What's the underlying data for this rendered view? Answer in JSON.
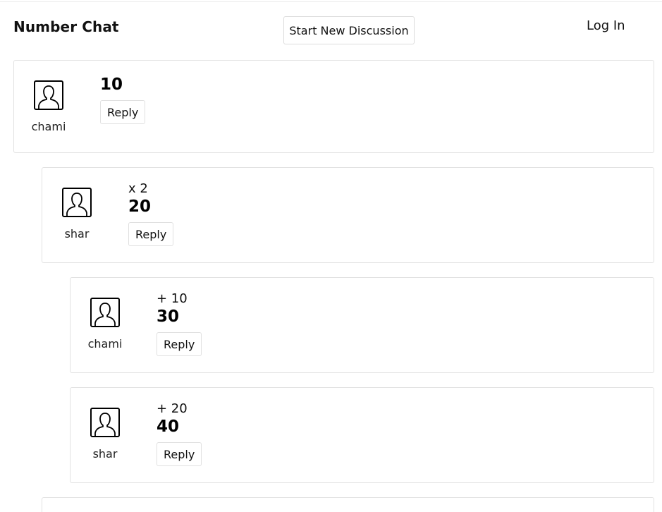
{
  "header": {
    "title": "Number Chat",
    "new_discussion_label": "Start New Discussion",
    "login_label": "Log In"
  },
  "posts": [
    {
      "username": "chami",
      "operation": "",
      "value": "10",
      "reply_label": "Reply",
      "avatar_icon": "user-silhouette-icon"
    },
    {
      "username": "shar",
      "operation": "x 2",
      "value": "20",
      "reply_label": "Reply",
      "avatar_icon": "user-silhouette-icon"
    },
    {
      "username": "chami",
      "operation": "+ 10",
      "value": "30",
      "reply_label": "Reply",
      "avatar_icon": "user-silhouette-icon"
    },
    {
      "username": "shar",
      "operation": "+ 20",
      "value": "40",
      "reply_label": "Reply",
      "avatar_icon": "user-silhouette-icon"
    }
  ]
}
